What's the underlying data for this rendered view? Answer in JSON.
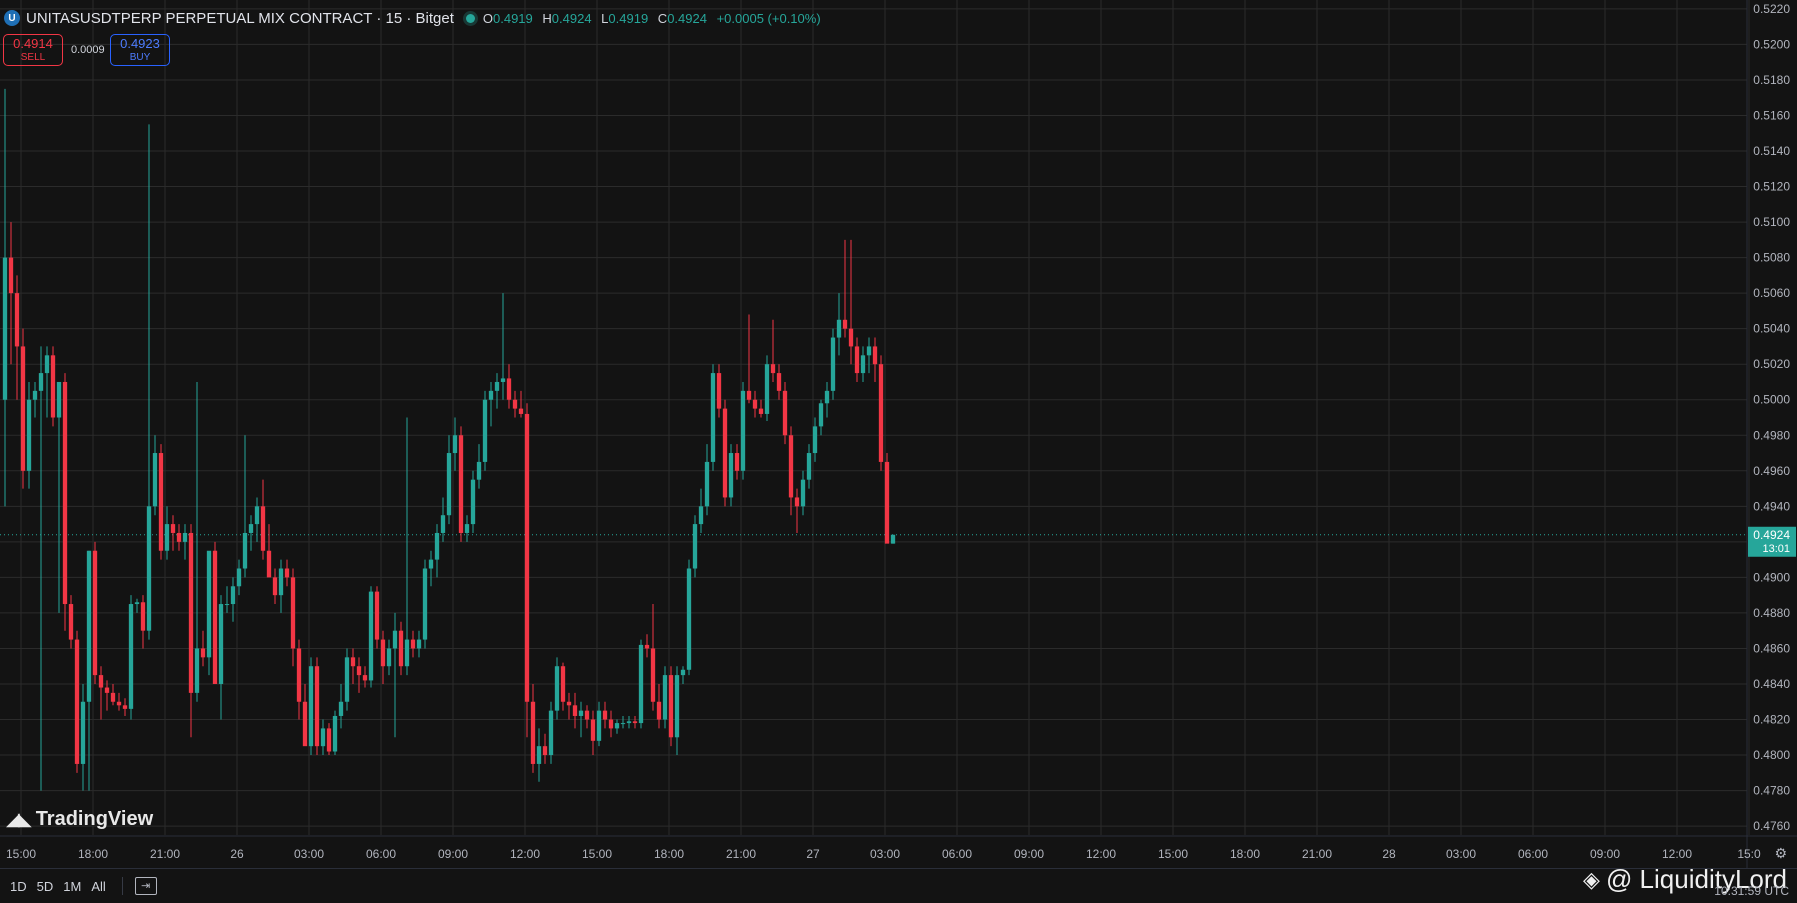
{
  "header": {
    "logo_glyph": "U",
    "title": "UNITASUSDTPERP PERPETUAL MIX CONTRACT · 15 · Bitget",
    "ohlc": {
      "o_label": "O",
      "o": "0.4919",
      "h_label": "H",
      "h": "0.4924",
      "l_label": "L",
      "l": "0.4919",
      "c_label": "C",
      "c": "0.4924",
      "change": "+0.0005 (+0.10%)"
    }
  },
  "trade": {
    "sell_price": "0.4914",
    "sell_label": "SELL",
    "spread": "0.0009",
    "buy_price": "0.4923",
    "buy_label": "BUY"
  },
  "last_price": {
    "value": "0.4924",
    "countdown": "13:01"
  },
  "branding": {
    "tradingview": "TradingView",
    "watermark": "@ LiquidityLord"
  },
  "bottom": {
    "ranges": [
      "1D",
      "5D",
      "1M",
      "All"
    ],
    "clock": "10:31:59 UTC"
  },
  "colors": {
    "bg": "#131313",
    "grid": "#2b2b2b",
    "up": "#26a69a",
    "down": "#f23645",
    "text": "#b2b5be"
  },
  "chart_data": {
    "type": "candlestick",
    "interval": "15",
    "ylim": [
      0.4755,
      0.5225
    ],
    "y_ticks": [
      "0.4760",
      "0.4780",
      "0.4800",
      "0.4820",
      "0.4840",
      "0.4860",
      "0.4880",
      "0.4900",
      "0.4920",
      "0.4940",
      "0.4960",
      "0.4980",
      "0.5000",
      "0.5020",
      "0.5040",
      "0.5060",
      "0.5080",
      "0.5100",
      "0.5120",
      "0.5140",
      "0.5160",
      "0.5180",
      "0.5200",
      "0.5220"
    ],
    "x_ticks": [
      "15:00",
      "18:00",
      "21:00",
      "26",
      "03:00",
      "06:00",
      "09:00",
      "12:00",
      "15:00",
      "18:00",
      "21:00",
      "27",
      "03:00",
      "06:00",
      "09:00",
      "12:00",
      "15:00",
      "18:00",
      "21:00",
      "28",
      "03:00",
      "06:00",
      "09:00",
      "12:00",
      "15:0"
    ],
    "grid": true,
    "candles": [
      {
        "o": 0.5,
        "h": 0.5175,
        "l": 0.494,
        "c": 0.508
      },
      {
        "o": 0.508,
        "h": 0.51,
        "l": 0.502,
        "c": 0.506
      },
      {
        "o": 0.506,
        "h": 0.507,
        "l": 0.5,
        "c": 0.503
      },
      {
        "o": 0.503,
        "h": 0.504,
        "l": 0.495,
        "c": 0.496
      },
      {
        "o": 0.496,
        "h": 0.501,
        "l": 0.495,
        "c": 0.5
      },
      {
        "o": 0.5,
        "h": 0.501,
        "l": 0.499,
        "c": 0.5005
      },
      {
        "o": 0.5005,
        "h": 0.503,
        "l": 0.478,
        "c": 0.5015
      },
      {
        "o": 0.5015,
        "h": 0.503,
        "l": 0.499,
        "c": 0.5025
      },
      {
        "o": 0.5025,
        "h": 0.503,
        "l": 0.4985,
        "c": 0.499
      },
      {
        "o": 0.499,
        "h": 0.501,
        "l": 0.488,
        "c": 0.501
      },
      {
        "o": 0.501,
        "h": 0.5015,
        "l": 0.487,
        "c": 0.4885
      },
      {
        "o": 0.4885,
        "h": 0.489,
        "l": 0.486,
        "c": 0.4865
      },
      {
        "o": 0.4865,
        "h": 0.487,
        "l": 0.479,
        "c": 0.4795
      },
      {
        "o": 0.4795,
        "h": 0.484,
        "l": 0.478,
        "c": 0.483
      },
      {
        "o": 0.483,
        "h": 0.4915,
        "l": 0.478,
        "c": 0.4915
      },
      {
        "o": 0.4915,
        "h": 0.492,
        "l": 0.484,
        "c": 0.4845
      },
      {
        "o": 0.4845,
        "h": 0.485,
        "l": 0.482,
        "c": 0.4838
      },
      {
        "o": 0.4838,
        "h": 0.4842,
        "l": 0.4825,
        "c": 0.4835
      },
      {
        "o": 0.4835,
        "h": 0.484,
        "l": 0.4828,
        "c": 0.483
      },
      {
        "o": 0.483,
        "h": 0.4835,
        "l": 0.4825,
        "c": 0.4828
      },
      {
        "o": 0.4828,
        "h": 0.4832,
        "l": 0.4822,
        "c": 0.4826
      },
      {
        "o": 0.4826,
        "h": 0.489,
        "l": 0.482,
        "c": 0.4885
      },
      {
        "o": 0.4885,
        "h": 0.4888,
        "l": 0.488,
        "c": 0.4886
      },
      {
        "o": 0.4886,
        "h": 0.489,
        "l": 0.486,
        "c": 0.487
      },
      {
        "o": 0.487,
        "h": 0.5155,
        "l": 0.4865,
        "c": 0.494
      },
      {
        "o": 0.494,
        "h": 0.498,
        "l": 0.4935,
        "c": 0.497
      },
      {
        "o": 0.497,
        "h": 0.4975,
        "l": 0.491,
        "c": 0.4915
      },
      {
        "o": 0.4915,
        "h": 0.494,
        "l": 0.491,
        "c": 0.493
      },
      {
        "o": 0.493,
        "h": 0.4935,
        "l": 0.4915,
        "c": 0.4925
      },
      {
        "o": 0.4925,
        "h": 0.493,
        "l": 0.4915,
        "c": 0.492
      },
      {
        "o": 0.492,
        "h": 0.493,
        "l": 0.491,
        "c": 0.4925
      },
      {
        "o": 0.4925,
        "h": 0.493,
        "l": 0.481,
        "c": 0.4835
      },
      {
        "o": 0.4835,
        "h": 0.501,
        "l": 0.483,
        "c": 0.486
      },
      {
        "o": 0.486,
        "h": 0.487,
        "l": 0.485,
        "c": 0.4855
      },
      {
        "o": 0.4855,
        "h": 0.49,
        "l": 0.4845,
        "c": 0.4915
      },
      {
        "o": 0.4915,
        "h": 0.492,
        "l": 0.488,
        "c": 0.484
      },
      {
        "o": 0.484,
        "h": 0.489,
        "l": 0.482,
        "c": 0.4885
      },
      {
        "o": 0.4885,
        "h": 0.4895,
        "l": 0.488,
        "c": 0.4885
      },
      {
        "o": 0.4885,
        "h": 0.49,
        "l": 0.4875,
        "c": 0.4895
      },
      {
        "o": 0.4895,
        "h": 0.491,
        "l": 0.489,
        "c": 0.4905
      },
      {
        "o": 0.4905,
        "h": 0.498,
        "l": 0.49,
        "c": 0.4925
      },
      {
        "o": 0.4925,
        "h": 0.4935,
        "l": 0.4915,
        "c": 0.493
      },
      {
        "o": 0.493,
        "h": 0.4945,
        "l": 0.492,
        "c": 0.494
      },
      {
        "o": 0.494,
        "h": 0.4955,
        "l": 0.491,
        "c": 0.4915
      },
      {
        "o": 0.4915,
        "h": 0.493,
        "l": 0.4905,
        "c": 0.49
      },
      {
        "o": 0.49,
        "h": 0.4905,
        "l": 0.4885,
        "c": 0.489
      },
      {
        "o": 0.489,
        "h": 0.491,
        "l": 0.488,
        "c": 0.4905
      },
      {
        "o": 0.4905,
        "h": 0.491,
        "l": 0.4895,
        "c": 0.49
      },
      {
        "o": 0.49,
        "h": 0.4905,
        "l": 0.485,
        "c": 0.486
      },
      {
        "o": 0.486,
        "h": 0.4865,
        "l": 0.482,
        "c": 0.483
      },
      {
        "o": 0.483,
        "h": 0.484,
        "l": 0.481,
        "c": 0.4805
      },
      {
        "o": 0.4805,
        "h": 0.4855,
        "l": 0.48,
        "c": 0.485
      },
      {
        "o": 0.485,
        "h": 0.4855,
        "l": 0.48,
        "c": 0.4805
      },
      {
        "o": 0.4805,
        "h": 0.482,
        "l": 0.48,
        "c": 0.4815
      },
      {
        "o": 0.4815,
        "h": 0.4818,
        "l": 0.48,
        "c": 0.4802
      },
      {
        "o": 0.4802,
        "h": 0.4825,
        "l": 0.48,
        "c": 0.4822
      },
      {
        "o": 0.4822,
        "h": 0.484,
        "l": 0.4815,
        "c": 0.483
      },
      {
        "o": 0.483,
        "h": 0.486,
        "l": 0.4825,
        "c": 0.4855
      },
      {
        "o": 0.4855,
        "h": 0.486,
        "l": 0.484,
        "c": 0.485
      },
      {
        "o": 0.485,
        "h": 0.4855,
        "l": 0.4835,
        "c": 0.4845
      },
      {
        "o": 0.4845,
        "h": 0.485,
        "l": 0.4838,
        "c": 0.4842
      },
      {
        "o": 0.4842,
        "h": 0.4895,
        "l": 0.4838,
        "c": 0.4892
      },
      {
        "o": 0.4892,
        "h": 0.4895,
        "l": 0.486,
        "c": 0.4865
      },
      {
        "o": 0.4865,
        "h": 0.487,
        "l": 0.484,
        "c": 0.485
      },
      {
        "o": 0.485,
        "h": 0.4865,
        "l": 0.4845,
        "c": 0.486
      },
      {
        "o": 0.486,
        "h": 0.488,
        "l": 0.481,
        "c": 0.487
      },
      {
        "o": 0.487,
        "h": 0.4875,
        "l": 0.4845,
        "c": 0.485
      },
      {
        "o": 0.485,
        "h": 0.499,
        "l": 0.4845,
        "c": 0.4865
      },
      {
        "o": 0.4865,
        "h": 0.487,
        "l": 0.4855,
        "c": 0.486
      },
      {
        "o": 0.486,
        "h": 0.487,
        "l": 0.4855,
        "c": 0.4865
      },
      {
        "o": 0.4865,
        "h": 0.491,
        "l": 0.486,
        "c": 0.4905
      },
      {
        "o": 0.4905,
        "h": 0.4915,
        "l": 0.4895,
        "c": 0.491
      },
      {
        "o": 0.491,
        "h": 0.493,
        "l": 0.49,
        "c": 0.4925
      },
      {
        "o": 0.4925,
        "h": 0.4945,
        "l": 0.492,
        "c": 0.4935
      },
      {
        "o": 0.4935,
        "h": 0.498,
        "l": 0.493,
        "c": 0.497
      },
      {
        "o": 0.497,
        "h": 0.499,
        "l": 0.496,
        "c": 0.498
      },
      {
        "o": 0.498,
        "h": 0.4985,
        "l": 0.492,
        "c": 0.4925
      },
      {
        "o": 0.4925,
        "h": 0.4935,
        "l": 0.492,
        "c": 0.493
      },
      {
        "o": 0.493,
        "h": 0.496,
        "l": 0.4925,
        "c": 0.4955
      },
      {
        "o": 0.4955,
        "h": 0.4975,
        "l": 0.495,
        "c": 0.4965
      },
      {
        "o": 0.4965,
        "h": 0.5005,
        "l": 0.496,
        "c": 0.5
      },
      {
        "o": 0.5,
        "h": 0.501,
        "l": 0.4985,
        "c": 0.5005
      },
      {
        "o": 0.5005,
        "h": 0.5015,
        "l": 0.4995,
        "c": 0.501
      },
      {
        "o": 0.501,
        "h": 0.506,
        "l": 0.5,
        "c": 0.5012
      },
      {
        "o": 0.5012,
        "h": 0.502,
        "l": 0.4995,
        "c": 0.5
      },
      {
        "o": 0.5,
        "h": 0.5005,
        "l": 0.499,
        "c": 0.4995
      },
      {
        "o": 0.4995,
        "h": 0.5005,
        "l": 0.499,
        "c": 0.4992
      },
      {
        "o": 0.4992,
        "h": 0.4998,
        "l": 0.481,
        "c": 0.483
      },
      {
        "o": 0.483,
        "h": 0.484,
        "l": 0.479,
        "c": 0.4795
      },
      {
        "o": 0.4795,
        "h": 0.4815,
        "l": 0.4785,
        "c": 0.4805
      },
      {
        "o": 0.4805,
        "h": 0.4812,
        "l": 0.4795,
        "c": 0.48
      },
      {
        "o": 0.48,
        "h": 0.483,
        "l": 0.4795,
        "c": 0.4825
      },
      {
        "o": 0.4825,
        "h": 0.4855,
        "l": 0.482,
        "c": 0.485
      },
      {
        "o": 0.485,
        "h": 0.4852,
        "l": 0.4825,
        "c": 0.483
      },
      {
        "o": 0.483,
        "h": 0.4835,
        "l": 0.482,
        "c": 0.4828
      },
      {
        "o": 0.4828,
        "h": 0.4835,
        "l": 0.4815,
        "c": 0.4822
      },
      {
        "o": 0.4822,
        "h": 0.483,
        "l": 0.481,
        "c": 0.4825
      },
      {
        "o": 0.4825,
        "h": 0.4828,
        "l": 0.4815,
        "c": 0.482
      },
      {
        "o": 0.482,
        "h": 0.4825,
        "l": 0.48,
        "c": 0.4808
      },
      {
        "o": 0.4808,
        "h": 0.483,
        "l": 0.4805,
        "c": 0.4825
      },
      {
        "o": 0.4825,
        "h": 0.483,
        "l": 0.4815,
        "c": 0.482
      },
      {
        "o": 0.482,
        "h": 0.4825,
        "l": 0.481,
        "c": 0.4815
      },
      {
        "o": 0.4815,
        "h": 0.482,
        "l": 0.4812,
        "c": 0.4818
      },
      {
        "o": 0.4818,
        "h": 0.4822,
        "l": 0.4815,
        "c": 0.4818
      },
      {
        "o": 0.4818,
        "h": 0.4822,
        "l": 0.4815,
        "c": 0.4819
      },
      {
        "o": 0.4819,
        "h": 0.4822,
        "l": 0.4815,
        "c": 0.4818
      },
      {
        "o": 0.4818,
        "h": 0.4865,
        "l": 0.4815,
        "c": 0.4862
      },
      {
        "o": 0.4862,
        "h": 0.4868,
        "l": 0.4855,
        "c": 0.486
      },
      {
        "o": 0.486,
        "h": 0.4885,
        "l": 0.4825,
        "c": 0.483
      },
      {
        "o": 0.483,
        "h": 0.484,
        "l": 0.4815,
        "c": 0.482
      },
      {
        "o": 0.482,
        "h": 0.485,
        "l": 0.4815,
        "c": 0.4845
      },
      {
        "o": 0.4845,
        "h": 0.485,
        "l": 0.4805,
        "c": 0.481
      },
      {
        "o": 0.481,
        "h": 0.485,
        "l": 0.48,
        "c": 0.4845
      },
      {
        "o": 0.4845,
        "h": 0.485,
        "l": 0.484,
        "c": 0.4848
      },
      {
        "o": 0.4848,
        "h": 0.491,
        "l": 0.4845,
        "c": 0.4905
      },
      {
        "o": 0.4905,
        "h": 0.4935,
        "l": 0.49,
        "c": 0.493
      },
      {
        "o": 0.493,
        "h": 0.495,
        "l": 0.4925,
        "c": 0.494
      },
      {
        "o": 0.494,
        "h": 0.4975,
        "l": 0.4935,
        "c": 0.4965
      },
      {
        "o": 0.4965,
        "h": 0.502,
        "l": 0.496,
        "c": 0.5015
      },
      {
        "o": 0.5015,
        "h": 0.502,
        "l": 0.499,
        "c": 0.4995
      },
      {
        "o": 0.4995,
        "h": 0.5,
        "l": 0.494,
        "c": 0.4945
      },
      {
        "o": 0.4945,
        "h": 0.4975,
        "l": 0.494,
        "c": 0.497
      },
      {
        "o": 0.497,
        "h": 0.4975,
        "l": 0.4955,
        "c": 0.496
      },
      {
        "o": 0.496,
        "h": 0.501,
        "l": 0.4955,
        "c": 0.5005
      },
      {
        "o": 0.5005,
        "h": 0.5048,
        "l": 0.4998,
        "c": 0.5
      },
      {
        "o": 0.5,
        "h": 0.5005,
        "l": 0.499,
        "c": 0.4995
      },
      {
        "o": 0.4995,
        "h": 0.5,
        "l": 0.499,
        "c": 0.4992
      },
      {
        "o": 0.4992,
        "h": 0.5025,
        "l": 0.4988,
        "c": 0.502
      },
      {
        "o": 0.502,
        "h": 0.5045,
        "l": 0.501,
        "c": 0.5015
      },
      {
        "o": 0.5015,
        "h": 0.502,
        "l": 0.5,
        "c": 0.5005
      },
      {
        "o": 0.5005,
        "h": 0.501,
        "l": 0.4975,
        "c": 0.498
      },
      {
        "o": 0.498,
        "h": 0.4985,
        "l": 0.4935,
        "c": 0.4945
      },
      {
        "o": 0.4945,
        "h": 0.495,
        "l": 0.4925,
        "c": 0.494
      },
      {
        "o": 0.494,
        "h": 0.496,
        "l": 0.4935,
        "c": 0.4955
      },
      {
        "o": 0.4955,
        "h": 0.4975,
        "l": 0.495,
        "c": 0.497
      },
      {
        "o": 0.497,
        "h": 0.499,
        "l": 0.4965,
        "c": 0.4985
      },
      {
        "o": 0.4985,
        "h": 0.5,
        "l": 0.498,
        "c": 0.4998
      },
      {
        "o": 0.4998,
        "h": 0.501,
        "l": 0.499,
        "c": 0.5005
      },
      {
        "o": 0.5005,
        "h": 0.504,
        "l": 0.5,
        "c": 0.5035
      },
      {
        "o": 0.5035,
        "h": 0.506,
        "l": 0.5025,
        "c": 0.5045
      },
      {
        "o": 0.5045,
        "h": 0.509,
        "l": 0.5035,
        "c": 0.504
      },
      {
        "o": 0.504,
        "h": 0.509,
        "l": 0.502,
        "c": 0.503
      },
      {
        "o": 0.503,
        "h": 0.5035,
        "l": 0.501,
        "c": 0.5015
      },
      {
        "o": 0.5015,
        "h": 0.503,
        "l": 0.501,
        "c": 0.5025
      },
      {
        "o": 0.5025,
        "h": 0.5035,
        "l": 0.5015,
        "c": 0.503
      },
      {
        "o": 0.503,
        "h": 0.5035,
        "l": 0.501,
        "c": 0.502
      },
      {
        "o": 0.502,
        "h": 0.5025,
        "l": 0.496,
        "c": 0.4965
      },
      {
        "o": 0.4965,
        "h": 0.497,
        "l": 0.492,
        "c": 0.4919
      },
      {
        "o": 0.4919,
        "h": 0.4924,
        "l": 0.4919,
        "c": 0.4924
      }
    ]
  }
}
